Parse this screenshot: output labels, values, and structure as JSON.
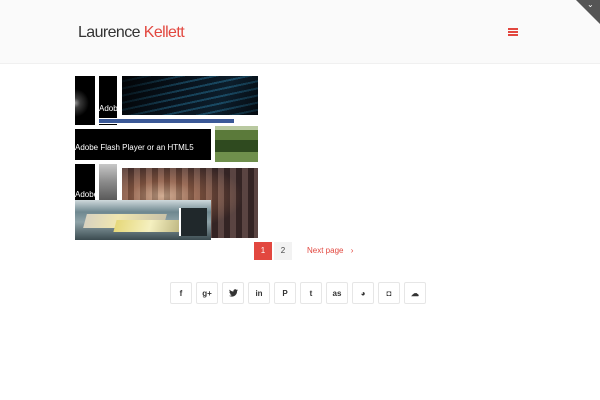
{
  "header": {
    "logo_first": "Laurence",
    "logo_last": "Kellett",
    "menu_icon": "hamburger-menu-icon",
    "corner_icon": "chevron-down-icon"
  },
  "gallery": {
    "captions": {
      "adobe_short": "Adobe",
      "flash_text": "Adobe Flash Player or an HTML5",
      "adobe_bottom": "Adobe"
    }
  },
  "pagination": {
    "current": "1",
    "next_page_number": "2",
    "next_label": "Next page",
    "next_icon": "›"
  },
  "social": [
    {
      "name": "facebook-icon",
      "glyph": "f"
    },
    {
      "name": "google-plus-icon",
      "glyph": "g+"
    },
    {
      "name": "twitter-icon",
      "glyph": "🐦"
    },
    {
      "name": "linkedin-icon",
      "glyph": "in"
    },
    {
      "name": "pinterest-icon",
      "glyph": "P"
    },
    {
      "name": "tumblr-icon",
      "glyph": "t"
    },
    {
      "name": "lastfm-icon",
      "glyph": "as"
    },
    {
      "name": "github-icon",
      "glyph": "◕"
    },
    {
      "name": "instagram-icon",
      "glyph": "◘"
    },
    {
      "name": "soundcloud-icon",
      "glyph": "☁"
    }
  ],
  "colors": {
    "accent": "#e2473f",
    "header_bg": "#fafafa",
    "text_dark": "#333333"
  }
}
